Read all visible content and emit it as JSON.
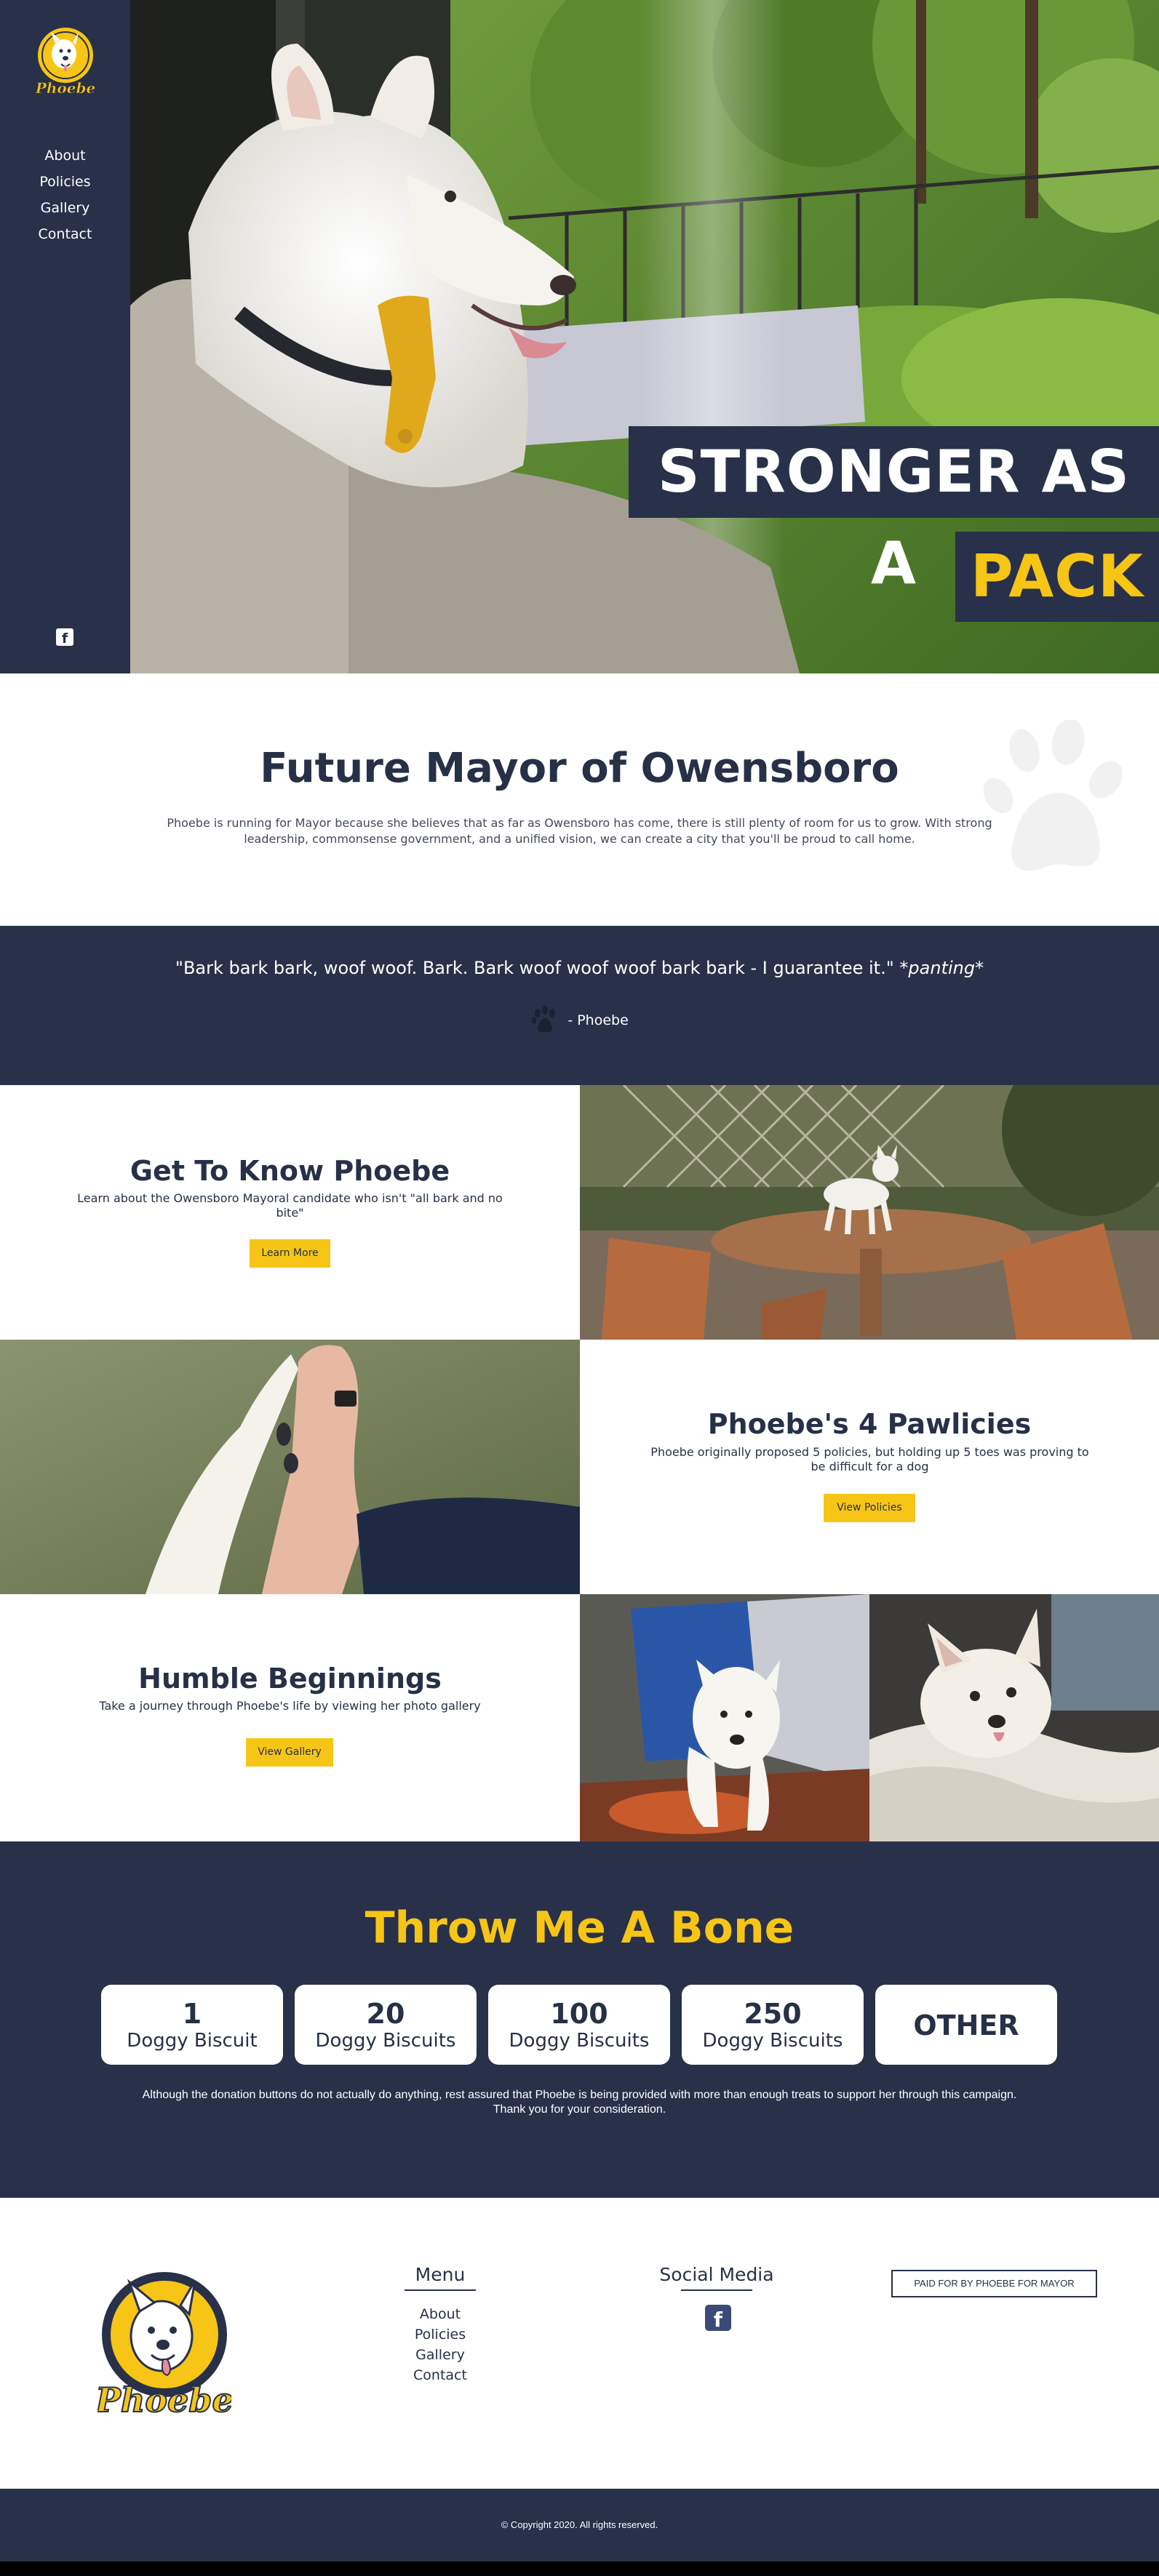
{
  "colors": {
    "navy": "#283149",
    "accent_yellow": "#f6c516",
    "white": "#ffffff"
  },
  "brand": {
    "logo_text": "Phoebe"
  },
  "nav": {
    "items": [
      {
        "label": "About"
      },
      {
        "label": "Policies"
      },
      {
        "label": "Gallery"
      },
      {
        "label": "Contact"
      }
    ],
    "social_icon": "facebook-icon"
  },
  "hero": {
    "slogan_line1": "STRONGER AS A",
    "slogan_line2": "PACK",
    "photo": "white dog with yellow chew toy looking out window"
  },
  "intro": {
    "title": "Future Mayor of Owensboro",
    "body": "Phoebe is running for Mayor because she believes that as far as Owensboro has come, there is still plenty of room for us to grow. With strong leadership, commonsense government, and a unified vision, we can create a city that you'll be proud to call home."
  },
  "quote": {
    "text_main": "\"Bark bark bark, woof woof. Bark. Bark woof woof woof bark bark - I guarantee it.\" ",
    "text_emph": "*panting*",
    "attribution": "- Phoebe"
  },
  "features": [
    {
      "title": "Get To Know Phoebe",
      "body": "Learn about the Owensboro Mayoral candidate who isn't \"all bark and no bite\"",
      "button": "Learn More"
    },
    {
      "title": "Phoebe's 4 Pawlicies",
      "body": "Phoebe originally proposed 5 policies, but holding up 5 toes was proving to be difficult for a dog",
      "button": "View Policies"
    },
    {
      "title": "Humble Beginnings",
      "body": "Take a journey through Phoebe's life by viewing her photo gallery",
      "button": "View Gallery"
    }
  ],
  "donate": {
    "title": "Throw Me A Bone",
    "options": [
      {
        "amount": "1",
        "unit": "Doggy Biscuit"
      },
      {
        "amount": "20",
        "unit": "Doggy Biscuits"
      },
      {
        "amount": "100",
        "unit": "Doggy Biscuits"
      },
      {
        "amount": "250",
        "unit": "Doggy Biscuits"
      },
      {
        "amount": "OTHER",
        "unit": ""
      }
    ],
    "note_line1": "Although the donation buttons do not actually do anything, rest assured that Phoebe is being provided with more than enough treats to support her through this campaign.",
    "note_line2": "Thank you for your consideration."
  },
  "footer": {
    "menu_title": "Menu",
    "menu_items": [
      {
        "label": "About"
      },
      {
        "label": "Policies"
      },
      {
        "label": "Gallery"
      },
      {
        "label": "Contact"
      }
    ],
    "social_title": "Social Media",
    "paid_for": "PAID FOR BY PHOEBE FOR MAYOR",
    "copyright": "© Copyright 2020. All rights reserved."
  }
}
